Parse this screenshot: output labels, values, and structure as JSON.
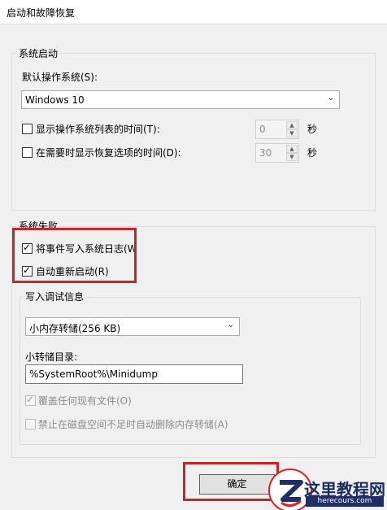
{
  "window": {
    "title": "启动和故障恢复"
  },
  "system_startup": {
    "legend": "系统启动",
    "default_os_label": "默认操作系统(S):",
    "default_os_value": "Windows 10",
    "show_os_list_label": "显示操作系统列表的时间(T):",
    "show_os_list_value": "0",
    "show_recovery_label": "在需要时显示恢复选项的时间(D):",
    "show_recovery_value": "30",
    "seconds_unit": "秒"
  },
  "system_failure": {
    "legend": "系统失败",
    "write_event_log_label": "将事件写入系统日志(W",
    "auto_restart_label": "自动重新启动(R)",
    "debug_info": {
      "legend": "写入调试信息",
      "dump_type_value": "小内存转储(256 KB)",
      "dump_dir_label": "小转储目录:",
      "dump_dir_value": "%SystemRoot%\\Minidump",
      "overwrite_label": "覆盖任何现有文件(O)",
      "disable_auto_delete_label": "禁止在磁盘空间不足时自动删除内存转储(A)"
    }
  },
  "buttons": {
    "ok_label": "确定"
  },
  "watermark": {
    "title": "这里教程网",
    "subtitle": "herecours.com"
  },
  "colors": {
    "highlight": "#c8252b",
    "focus_border": "#0078d7"
  }
}
